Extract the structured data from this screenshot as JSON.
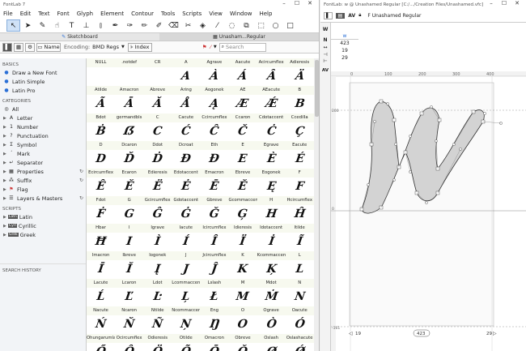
{
  "left_window": {
    "title": "FontLab 7",
    "menu": [
      "File",
      "Edit",
      "Text",
      "Font",
      "Glyph",
      "Element",
      "Contour",
      "Tools",
      "Scripts",
      "View",
      "Window",
      "Help"
    ],
    "tabs": [
      "Sketchboard",
      "Unasham...Regular"
    ],
    "fontwindow_bar": {
      "name_label": "Name",
      "encoding_label": "Encoding:",
      "encoding_value": "BMD Regs",
      "index_label": "Index",
      "search_placeholder": "Search"
    },
    "sidebar": {
      "basics_header": "BASICS",
      "basics": [
        "Draw a New Font",
        "Latin Simple",
        "Latin Pro"
      ],
      "categories_header": "CATEGORIES",
      "categories": [
        "All",
        "Letter",
        "Number",
        "Punctuation",
        "Symbol",
        "Mark",
        "Separator",
        "Properties",
        "Suffix",
        "Flag",
        "Layers & Masters"
      ],
      "scripts_header": "SCRIPTS",
      "scripts": [
        {
          "tag": "Latn",
          "label": "Latin"
        },
        {
          "tag": "Cyrl",
          "label": "Cyrillic"
        },
        {
          "tag": "Grek",
          "label": "Greek"
        }
      ],
      "search_history_header": "SEARCH HISTORY"
    },
    "glyph_rows": [
      {
        "names": [
          "NULL",
          ".notdef",
          "CR",
          "A",
          "Agrave",
          "Aacute",
          "Acircumflex",
          "Adieresis"
        ],
        "glyphs": [
          "",
          "",
          "",
          "A",
          "À",
          "Á",
          "Â",
          "Ä"
        ]
      },
      {
        "names": [
          "Atilde",
          "Amacron",
          "Abreve",
          "Aring",
          "Aogonek",
          "AE",
          "AEacute",
          "B"
        ],
        "glyphs": [
          "Ã",
          "Ā",
          "Ă",
          "Å",
          "Ą",
          "Æ",
          "Ǽ",
          "B"
        ]
      },
      {
        "names": [
          "Bdot",
          "germandbls",
          "C",
          "Cacute",
          "Ccircumflex",
          "Ccaron",
          "Cdotaccent",
          "Ccedilla"
        ],
        "glyphs": [
          "Ḃ",
          "ẞ",
          "C",
          "Ć",
          "Ĉ",
          "Č",
          "Ċ",
          "Ç"
        ]
      },
      {
        "names": [
          "D",
          "Dcaron",
          "Ddot",
          "Dcroat",
          "Eth",
          "E",
          "Egrave",
          "Eacute"
        ],
        "glyphs": [
          "D",
          "Ď",
          "Ḋ",
          "Đ",
          "Ð",
          "E",
          "È",
          "É"
        ]
      },
      {
        "names": [
          "Ecircumflex",
          "Ecaron",
          "Edieresis",
          "Edotaccent",
          "Emacron",
          "Ebreve",
          "Eogonek",
          "F"
        ],
        "glyphs": [
          "Ê",
          "Ě",
          "Ë",
          "Ė",
          "Ē",
          "Ĕ",
          "Ę",
          "F"
        ]
      },
      {
        "names": [
          "Fdot",
          "G",
          "Gcircumflex",
          "Gdotaccent",
          "Gbreve",
          "Gcommaccent",
          "H",
          "Hcircumflex"
        ],
        "glyphs": [
          "Ḟ",
          "G",
          "Ĝ",
          "Ġ",
          "Ğ",
          "Ģ",
          "H",
          "Ĥ"
        ]
      },
      {
        "names": [
          "Hbar",
          "I",
          "Igrave",
          "Iacute",
          "Icircumflex",
          "Idieresis",
          "Idotaccent",
          "Itilde"
        ],
        "glyphs": [
          "Ħ",
          "I",
          "Ì",
          "Í",
          "Î",
          "Ï",
          "İ",
          "Ĩ"
        ]
      },
      {
        "names": [
          "Imacron",
          "Ibreve",
          "Iogonek",
          "J",
          "Jcircumflex",
          "K",
          "Kcommaccent",
          "L"
        ],
        "glyphs": [
          "Ī",
          "Ĭ",
          "Į",
          "J",
          "Ĵ",
          "K",
          "Ķ",
          "L"
        ]
      },
      {
        "names": [
          "Lacute",
          "Lcaron",
          "Ldot",
          "Lcommaccent",
          "Lslash",
          "M",
          "Mdot",
          "N"
        ],
        "glyphs": [
          "Ĺ",
          "Ľ",
          "Ŀ",
          "Ļ",
          "Ł",
          "M",
          "Ṁ",
          "N"
        ]
      },
      {
        "names": [
          "Nacute",
          "Ncaron",
          "Ntilde",
          "Ncommaccent",
          "Eng",
          "O",
          "Ograve",
          "Oacute"
        ],
        "glyphs": [
          "Ń",
          "Ň",
          "Ñ",
          "Ņ",
          "Ŋ",
          "O",
          "Ò",
          "Ó"
        ]
      },
      {
        "names": [
          "Ohungarumlaut",
          "Ocircumflex",
          "Odieresis",
          "Otilde",
          "Omacron",
          "Obreve",
          "Oslash",
          "Oslashacute"
        ],
        "glyphs": [
          "Ő",
          "Ô",
          "Ö",
          "Õ",
          "Ō",
          "Ŏ",
          "Ø",
          "Ǿ"
        ]
      }
    ]
  },
  "right_window": {
    "title": "FontLab: w @ Unashamed Regular [C:/.../Creation Files/Unashamed.vfc]",
    "font_selector": "Unashamed Regular",
    "glyph_name": "w",
    "metrics": {
      "glyph": "w",
      "width": "423",
      "lsb": "19",
      "rsb": "29"
    },
    "ruler_ticks": [
      "0",
      "100",
      "200",
      "300",
      "400"
    ],
    "vruler_ticks": [
      "200",
      "0"
    ],
    "bottom_metrics": {
      "lsb": "19",
      "width": "423",
      "rsb": "29"
    },
    "side_labels": [
      "W",
      "N"
    ],
    "guide_label": "-161",
    "zone_label": "AV"
  }
}
